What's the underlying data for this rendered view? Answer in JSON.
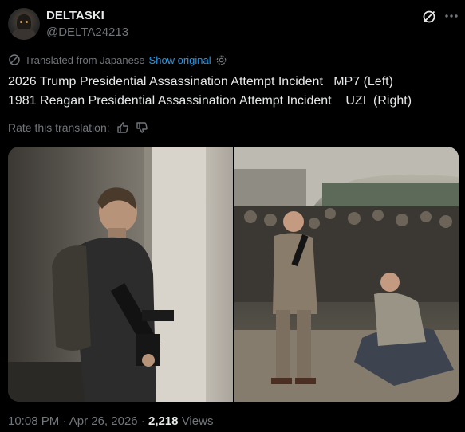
{
  "author": {
    "display_name": "DELTASKI",
    "handle": "@DELTA24213"
  },
  "header_icons": [
    "grok-icon",
    "more-icon"
  ],
  "translation": {
    "notice": "Translated from Japanese",
    "show_original": "Show original",
    "icon": "translate-icon",
    "settings_icon": "gear-icon"
  },
  "post": {
    "line1": "2026 Trump Presidential Assassination Attempt Incident   MP7 (Left)",
    "line2": "1981 Reagan Presidential Assassination Attempt Incident    UZI  (Right)"
  },
  "rate": {
    "label": "Rate this translation:",
    "icons": [
      "thumbs-up-icon",
      "thumbs-down-icon"
    ]
  },
  "footer": {
    "time": "10:08 PM",
    "separator": " · ",
    "date": "Apr 26, 2026",
    "views_count": "2,218",
    "views_label": " Views"
  },
  "colors": {
    "background": "#000000",
    "text": "#e7e9ea",
    "muted": "#71767b",
    "link": "#1d9bf0"
  }
}
